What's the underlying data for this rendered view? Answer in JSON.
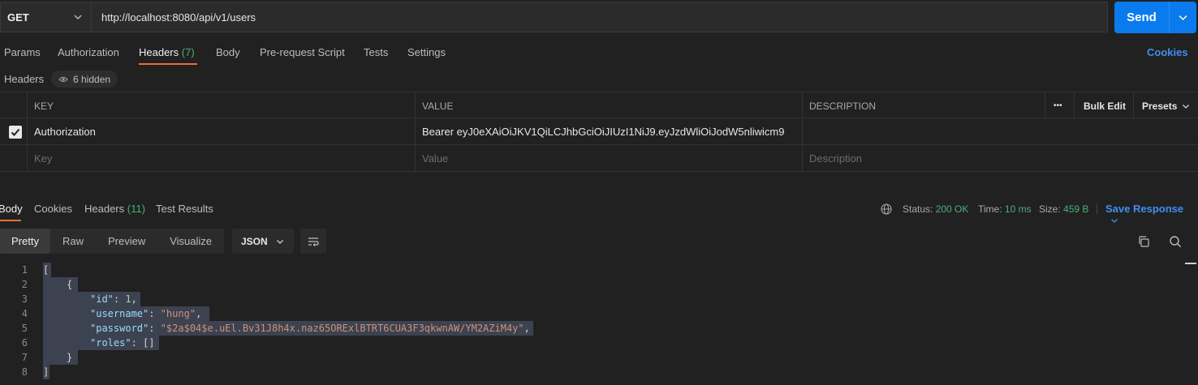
{
  "request": {
    "method": "GET",
    "url": "http://localhost:8080/api/v1/users",
    "send_label": "Send"
  },
  "request_tabs": {
    "params": "Params",
    "authorization": "Authorization",
    "headers": "Headers",
    "headers_count": "(7)",
    "body": "Body",
    "pre_request": "Pre-request Script",
    "tests": "Tests",
    "settings": "Settings",
    "cookies": "Cookies"
  },
  "headers_section": {
    "label": "Headers",
    "hidden": "6 hidden"
  },
  "headers_table": {
    "col_key": "KEY",
    "col_value": "VALUE",
    "col_description": "DESCRIPTION",
    "more": "•••",
    "bulk_edit": "Bulk Edit",
    "presets": "Presets",
    "rows": [
      {
        "checked": true,
        "key": "Authorization",
        "value": "Bearer eyJ0eXAiOiJKV1QiLCJhbGciOiJIUzI1NiJ9.eyJzdWliOiJodW5nliwicm9",
        "description": ""
      }
    ],
    "placeholder": {
      "key": "Key",
      "value": "Value",
      "description": "Description"
    }
  },
  "response_tabs": {
    "body": "Body",
    "cookies": "Cookies",
    "headers": "Headers",
    "headers_count": "(11)",
    "test_results": "Test Results"
  },
  "response_status": {
    "status_label": "Status:",
    "status_value": "200 OK",
    "time_label": "Time:",
    "time_value": "10 ms",
    "size_label": "Size:",
    "size_value": "459 B",
    "save": "Save Response"
  },
  "view_modes": {
    "pretty": "Pretty",
    "raw": "Raw",
    "preview": "Preview",
    "visualize": "Visualize",
    "format": "JSON"
  },
  "code": {
    "line_numbers": [
      "1",
      "2",
      "3",
      "4",
      "5",
      "6",
      "7",
      "8"
    ],
    "l1": "[",
    "l2": "{",
    "id_key": "\"id\"",
    "id_val": "1",
    "username_key": "\"username\"",
    "username_val": "\"hung\"",
    "password_key": "\"password\"",
    "password_val": "\"$2a$04$e.uEl.Bv31J8h4x.naz65ORExlBTRT6CUA3F3qkwnAW/YM2AZiM4y\"",
    "roles_key": "\"roles\"",
    "roles_val": "[]",
    "l7": "}",
    "l8": "]"
  },
  "colors": {
    "accent": "#097bed",
    "tab_underline": "#f26b3a",
    "success": "#4caf7a",
    "link": "#3f8ff0",
    "background": "#212121"
  }
}
